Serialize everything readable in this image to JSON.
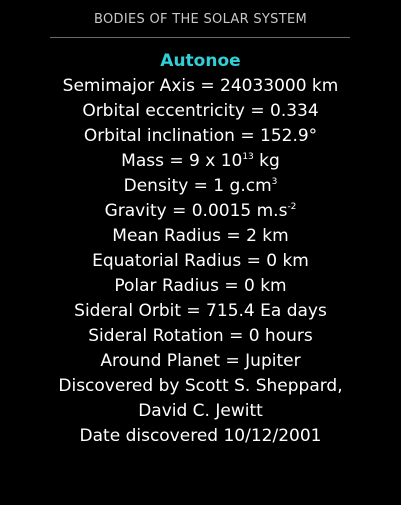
{
  "header": {
    "title": "BODIES OF THE SOLAR SYSTEM"
  },
  "colors": {
    "background": "#000000",
    "name_accent": "#30d0d8",
    "text": "#ffffff"
  },
  "body": {
    "name": "Autonoe",
    "semimajor_axis": "Semimajor Axis = 24033000 km",
    "orbital_eccentricity": "Orbital eccentricity = 0.334",
    "orbital_inclination": "Orbital inclination = 152.9°",
    "mass": {
      "prefix": "Mass = 9 x 10",
      "exponent": "13",
      "unit": " kg"
    },
    "density": {
      "prefix": "Density = 1 g.cm",
      "exponent": "3"
    },
    "gravity": {
      "prefix": "Gravity = 0.0015 m.s",
      "exponent": "-2"
    },
    "mean_radius": "Mean Radius = 2 km",
    "equatorial_radius": "Equatorial Radius = 0 km",
    "polar_radius": "Polar Radius = 0 km",
    "sideral_orbit": "Sideral Orbit = 715.4 Ea days",
    "sideral_rotation": "Sideral Rotation = 0 hours",
    "around_planet": "Around Planet = Jupiter",
    "discovered_by_line1": "Discovered by Scott S. Sheppard,",
    "discovered_by_line2": "David C. Jewitt",
    "date_discovered": "Date discovered 10/12/2001"
  }
}
